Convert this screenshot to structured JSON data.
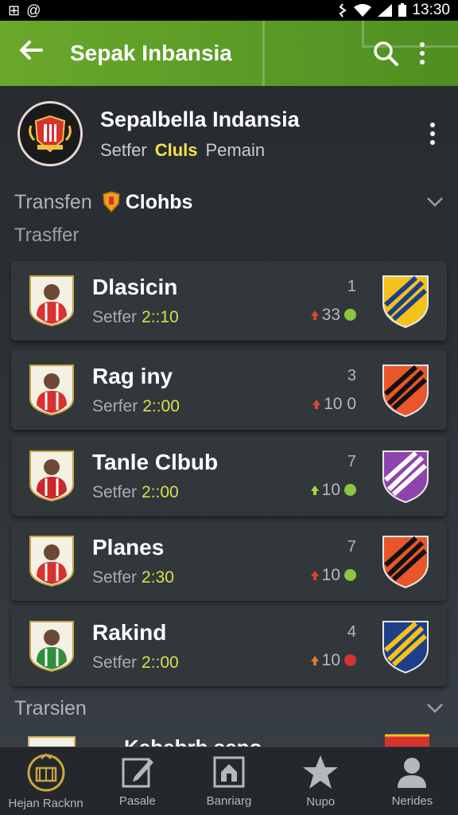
{
  "status_bar": {
    "time": "13:30",
    "left_icons": [
      "plus-square-icon",
      "at-icon"
    ]
  },
  "app_bar": {
    "title": "Sepak Inbansia"
  },
  "header": {
    "title": "Sepalbella Indansia",
    "tabs": [
      "Setfer",
      "Cluls",
      "Pemain"
    ],
    "active_tab": "Cluls"
  },
  "section1": {
    "label_a": "Transfen",
    "label_b": "Clohbs"
  },
  "subheading": "Trasffer",
  "rows": [
    {
      "name": "Dlasicin",
      "sub_label": "Setfer",
      "time": "2::10",
      "number": "1",
      "score": "33",
      "arrow_color": "#d9482b",
      "dot_color": "#8cc63f",
      "jersey": "#d8322e",
      "shield": [
        "#f4c21b",
        "#1d3f8a"
      ]
    },
    {
      "name": "Rag iny",
      "sub_label": "Serfer",
      "time": "2::00",
      "number": "3",
      "score": "10 0",
      "arrow_color": "#d9482b",
      "dot_color": "",
      "jersey": "#d8322e",
      "shield": [
        "#e8562a",
        "#111111"
      ]
    },
    {
      "name": "Tanle Clbub",
      "sub_label": "Setfer",
      "time": "2::00",
      "number": "7",
      "score": "10",
      "arrow_color": "#a6d63a",
      "dot_color": "#8cc63f",
      "jersey": "#c9272a",
      "shield": [
        "#8e44ad",
        "#ffffff"
      ]
    },
    {
      "name": "Planes",
      "sub_label": "Setfer",
      "time": "2:30",
      "number": "7",
      "score": "10",
      "arrow_color": "#d9482b",
      "dot_color": "#8cc63f",
      "jersey": "#d8322e",
      "shield": [
        "#e8562a",
        "#111111"
      ]
    },
    {
      "name": "Rakind",
      "sub_label": "Setfer",
      "time": "2::00",
      "number": "4",
      "score": "10",
      "arrow_color": "#e07a2b",
      "dot_color": "#d9322e",
      "jersey": "#2f8f3c",
      "shield": [
        "#1d3f8a",
        "#f4c21b"
      ]
    }
  ],
  "section2": {
    "label": "Trarsien"
  },
  "peek_row": {
    "name": "Kebebrh sepo"
  },
  "nav": [
    {
      "label": "Hejan Racknn",
      "icon": "stadium-icon"
    },
    {
      "label": "Pasale",
      "icon": "edit-icon"
    },
    {
      "label": "Banriarg",
      "icon": "home-icon"
    },
    {
      "label": "Nupo",
      "icon": "star-icon"
    },
    {
      "label": "Nerides",
      "icon": "person-icon"
    }
  ]
}
